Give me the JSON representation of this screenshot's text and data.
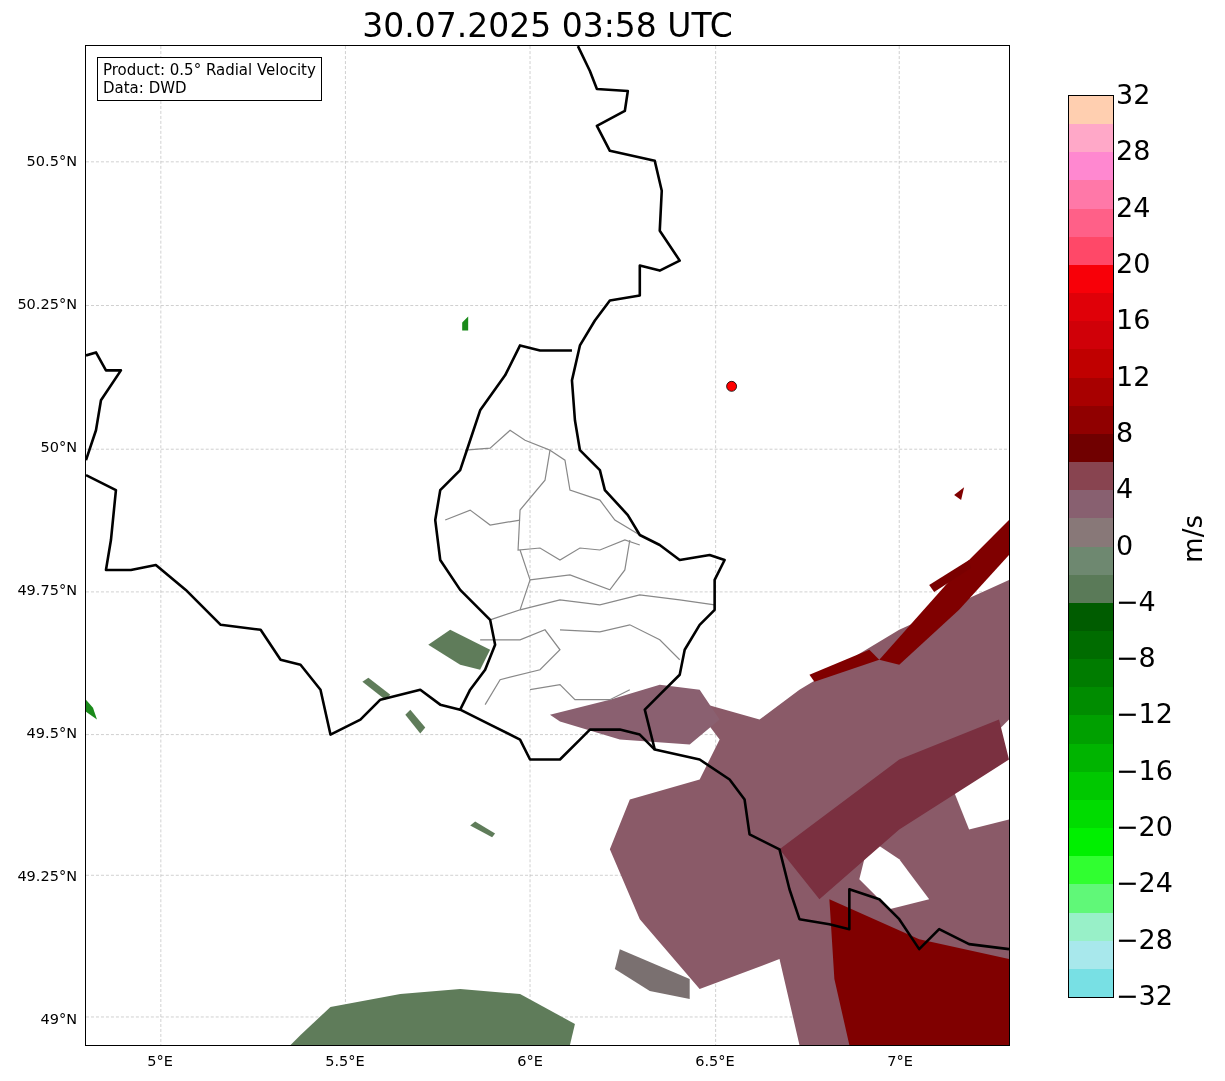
{
  "title": "30.07.2025 03:58 UTC",
  "info_box": {
    "lines": [
      "Product: 0.5° Radial Velocity",
      "Data: DWD"
    ]
  },
  "y_ticks": [
    "50.5°N",
    "50.25°N",
    "50°N",
    "49.75°N",
    "49.5°N",
    "49.25°N",
    "49°N"
  ],
  "x_ticks": [
    "5°E",
    "5.5°E",
    "6°E",
    "6.5°E",
    "7°E"
  ],
  "colorbar": {
    "label": "m/s",
    "ticks": [
      "32",
      "28",
      "24",
      "20",
      "16",
      "12",
      "8",
      "4",
      "0",
      "−4",
      "−8",
      "−12",
      "−16",
      "−20",
      "−24",
      "−28",
      "−32"
    ],
    "segments": [
      {
        "color": "#ffcfb0"
      },
      {
        "color": "#ffa8c8"
      },
      {
        "color": "#ff88d0"
      },
      {
        "color": "#ff78a8"
      },
      {
        "color": "#ff6088"
      },
      {
        "color": "#ff4868"
      },
      {
        "color": "#f80008"
      },
      {
        "color": "#e00008"
      },
      {
        "color": "#d00008"
      },
      {
        "color": "#c00000"
      },
      {
        "color": "#a80000"
      },
      {
        "color": "#900000"
      },
      {
        "color": "#700000"
      },
      {
        "color": "#884450"
      },
      {
        "color": "#886070"
      },
      {
        "color": "#887878"
      },
      {
        "color": "#6e8870"
      },
      {
        "color": "#5a7a58"
      },
      {
        "color": "#005c00"
      },
      {
        "color": "#006c00"
      },
      {
        "color": "#007c00"
      },
      {
        "color": "#008c00"
      },
      {
        "color": "#00a000"
      },
      {
        "color": "#00b400"
      },
      {
        "color": "#00c800"
      },
      {
        "color": "#00dc00"
      },
      {
        "color": "#00f000"
      },
      {
        "color": "#30ff30"
      },
      {
        "color": "#60f878"
      },
      {
        "color": "#98f0c8"
      },
      {
        "color": "#a8e8ec"
      },
      {
        "color": "#78e0e4"
      }
    ]
  }
}
